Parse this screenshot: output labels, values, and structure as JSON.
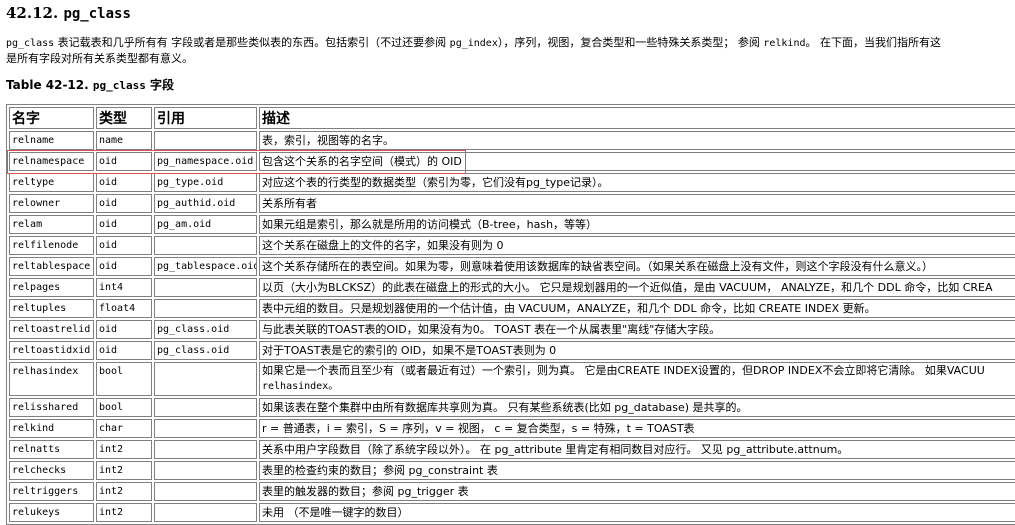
{
  "section": {
    "number": "42.12.",
    "name": "pg_class"
  },
  "intro": {
    "line1_parts": [
      "pg_class",
      " 表记载表和几乎所有有 字段或者是那些类似表的东西。包括索引（不过还要参阅 ",
      "pg_index",
      "），序列，视图，复合类型和一些特殊关系类型； 参阅 ",
      "relkind",
      "。 在下面，当我们指所有这"
    ],
    "line2": "是所有字段对所有关系类型都有意义。"
  },
  "caption": {
    "prefix": "Table 42-12. ",
    "name": "pg_class",
    "suffix": " 字段"
  },
  "table": {
    "headers": [
      "名字",
      "类型",
      "引用",
      "描述"
    ],
    "rows": [
      {
        "name": "relname",
        "type": "name",
        "ref": "",
        "desc": "表，索引，视图等的名字。"
      },
      {
        "name": "relnamespace",
        "type": "oid",
        "ref": "pg_namespace.oid",
        "desc": "包含这个关系的名字空间（模式）的 OID"
      },
      {
        "name": "reltype",
        "type": "oid",
        "ref": "pg_type.oid",
        "desc": "对应这个表的行类型的数据类型（索引为零，它们没有pg_type记录）。"
      },
      {
        "name": "relowner",
        "type": "oid",
        "ref": "pg_authid.oid",
        "desc": "关系所有者"
      },
      {
        "name": "relam",
        "type": "oid",
        "ref": "pg_am.oid",
        "desc": "如果元组是索引，那么就是所用的访问模式（B-tree，hash，等等）"
      },
      {
        "name": "relfilenode",
        "type": "oid",
        "ref": "",
        "desc": "这个关系在磁盘上的文件的名字，如果没有则为 0"
      },
      {
        "name": "reltablespace",
        "type": "oid",
        "ref": "pg_tablespace.oid",
        "desc": "这个关系存储所在的表空间。如果为零，则意味着使用该数据库的缺省表空间。（如果关系在磁盘上没有文件，则这个字段没有什么意义。）"
      },
      {
        "name": "relpages",
        "type": "int4",
        "ref": "",
        "desc": "以页（大小为BLCKSZ）的此表在磁盘上的形式的大小。 它只是规划器用的一个近似值，是由 VACUUM， ANALYZE，和几个 DDL 命令，比如 CREA"
      },
      {
        "name": "reltuples",
        "type": "float4",
        "ref": "",
        "desc": "表中元组的数目。只是规划器使用的一个估计值，由 VACUUM，ANALYZE，和几个 DDL 命令，比如 CREATE INDEX 更新。"
      },
      {
        "name": "reltoastrelid",
        "type": "oid",
        "ref": "pg_class.oid",
        "desc": "与此表关联的TOAST表的OID，如果没有为0。 TOAST 表在一个从属表里\"离线\"存储大字段。"
      },
      {
        "name": "reltoastidxid",
        "type": "oid",
        "ref": "pg_class.oid",
        "desc": "对于TOAST表是它的索引的 OID，如果不是TOAST表则为 0"
      },
      {
        "name": "relhasindex",
        "type": "bool",
        "ref": "",
        "desc": "如果它是一个表而且至少有（或者最近有过）一个索引，则为真。 它是由CREATE INDEX设置的，但DROP INDEX不会立即将它清除。 如果VACUU",
        "desc2": "relhasindex。"
      },
      {
        "name": "relisshared",
        "type": "bool",
        "ref": "",
        "desc": "如果该表在整个集群中由所有数据库共享则为真。 只有某些系统表(比如 pg_database) 是共享的。"
      },
      {
        "name": "relkind",
        "type": "char",
        "ref": "",
        "desc": "r = 普通表，i = 索引，S = 序列，v = 视图， c = 复合类型，s = 特殊，t = TOAST表"
      },
      {
        "name": "relnatts",
        "type": "int2",
        "ref": "",
        "desc": "关系中用户字段数目（除了系统字段以外）。 在 pg_attribute 里肯定有相同数目对应行。 又见 pg_attribute.attnum。"
      },
      {
        "name": "relchecks",
        "type": "int2",
        "ref": "",
        "desc": "表里的检查约束的数目；参阅 pg_constraint 表"
      },
      {
        "name": "reltriggers",
        "type": "int2",
        "ref": "",
        "desc": "表里的触发器的数目；参阅 pg_trigger 表"
      },
      {
        "name": "relukeys",
        "type": "int2",
        "ref": "",
        "desc": "未用 （不是唯一键字的数目）"
      }
    ]
  },
  "highlight": {
    "row": "relnamespace",
    "color": "#d9534f"
  }
}
